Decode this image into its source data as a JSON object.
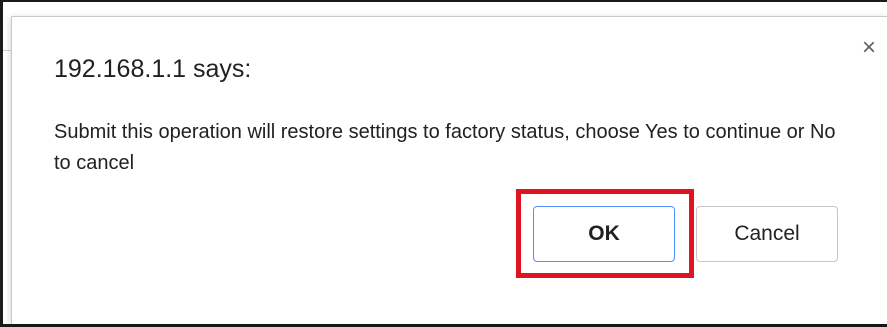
{
  "dialog": {
    "title": "192.168.1.1 says:",
    "message": "Submit this operation will restore settings to factory status, choose Yes to continue or No to cancel",
    "close_glyph": "×",
    "ok_label": "OK",
    "cancel_label": "Cancel"
  },
  "colors": {
    "highlight": "#e0141e",
    "ok_border": "#4d90fe",
    "text": "#202124"
  },
  "icons": {
    "close": "close-icon"
  }
}
